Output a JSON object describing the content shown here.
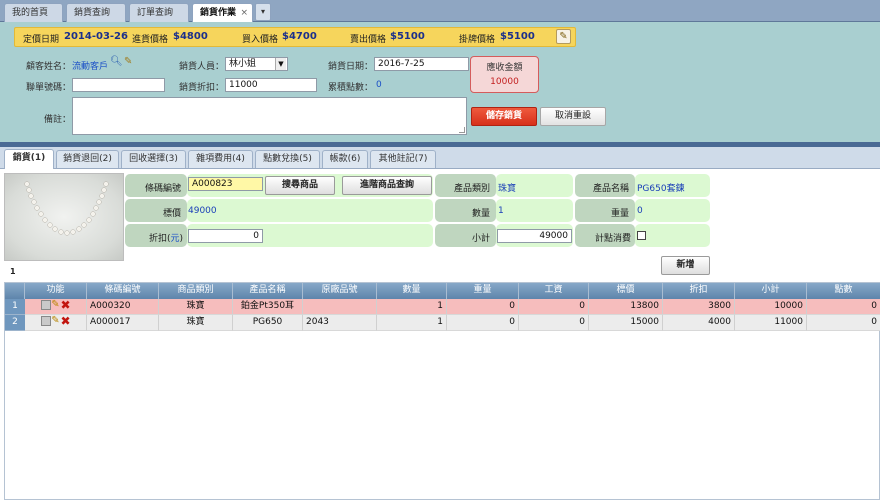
{
  "top_tabs": [
    {
      "label": "我的首頁",
      "active": false
    },
    {
      "label": "銷貨查詢",
      "active": false
    },
    {
      "label": "訂單查詢",
      "active": false
    },
    {
      "label": "銷貨作業",
      "active": true
    }
  ],
  "tab_close_glyph": "×",
  "tab_more_glyph": "▾",
  "price_strip": {
    "fixed_date_label": "定價日期",
    "fixed_date": "2014-03-26",
    "purchase_price_label": "進貨價格",
    "purchase_price": "$4800",
    "buyin_price_label": "買入價格",
    "buyin_price": "$4700",
    "sell_price_label": "賣出價格",
    "sell_price": "$5100",
    "list_price_label": "掛牌價格",
    "list_price": "$5100",
    "edit_icon": "pencil-icon"
  },
  "form": {
    "customer_label": "顧客姓名：",
    "customer_value": "流動客戶",
    "salesperson_label": "銷貨人員：",
    "salesperson_value": "林小姐",
    "sale_date_label": "銷貨日期：",
    "sale_date_value": "2016-7-25",
    "phone_label": "聯單號碼：",
    "phone_value": "",
    "discount_label": "銷貨折扣：",
    "discount_value": "11000",
    "points_label": "累積點數：",
    "points_value": "0",
    "notes_label": "備註：",
    "notes_value": "",
    "receivable_label": "應收金額",
    "receivable_value": "10000",
    "save_label": "儲存銷貨",
    "reset_label": "取消重設"
  },
  "sub_tabs": [
    {
      "label": "銷貨(1)",
      "active": true
    },
    {
      "label": "銷貨退回(2)",
      "active": false
    },
    {
      "label": "回收選擇(3)",
      "active": false
    },
    {
      "label": "雜項費用(4)",
      "active": false
    },
    {
      "label": "點數兌換(5)",
      "active": false
    },
    {
      "label": "帳款(6)",
      "active": false
    },
    {
      "label": "其他註記(7)",
      "active": false
    }
  ],
  "product": {
    "barcode_label": "條碼編號",
    "barcode_value": "A000823",
    "search_button": "搜尋商品",
    "advanced_search_button": "進階商品查詢",
    "category_label": "產品類別",
    "category_value": "珠寶",
    "name_label": "產品名稱",
    "name_value": "PG650套鍊",
    "list_price_label": "標價",
    "list_price_value": "49000",
    "quantity_label": "數量",
    "quantity_value": "1",
    "weight_label": "重量",
    "weight_value": "0",
    "discount_label": "折扣",
    "discount_unit": "元",
    "discount_value": "0",
    "subtotal_label": "小計",
    "subtotal_value": "49000",
    "points_check_label": "計點消費"
  },
  "pager": {
    "page": "1"
  },
  "add_label": "新增",
  "grid": {
    "columns": [
      "功能",
      "條碼編號",
      "商品類別",
      "產品名稱",
      "原廠品號",
      "數量",
      "重量",
      "工資",
      "標價",
      "折扣",
      "小計",
      "點數"
    ],
    "rows": [
      {
        "num": "1",
        "barcode": "A000320",
        "category": "珠寶",
        "name": "鉑金Pt350耳",
        "factory_no": "",
        "qty": "1",
        "weight": "0",
        "labor": "0",
        "price": "13800",
        "discount": "3800",
        "subtotal": "10000",
        "points": "0"
      },
      {
        "num": "2",
        "barcode": "A000017",
        "category": "珠寶",
        "name": "PG650",
        "factory_no": "2043",
        "qty": "1",
        "weight": "0",
        "labor": "0",
        "price": "15000",
        "discount": "4000",
        "subtotal": "11000",
        "points": "0"
      }
    ]
  },
  "colors": {
    "price_strip_bg": "#f6d55c",
    "form_bg": "#a9cfd0",
    "save_button": "#d7301a",
    "receivable_text": "#c32020",
    "row_highlight": "#f6bdbd",
    "grid_header": "#5e85ab"
  }
}
